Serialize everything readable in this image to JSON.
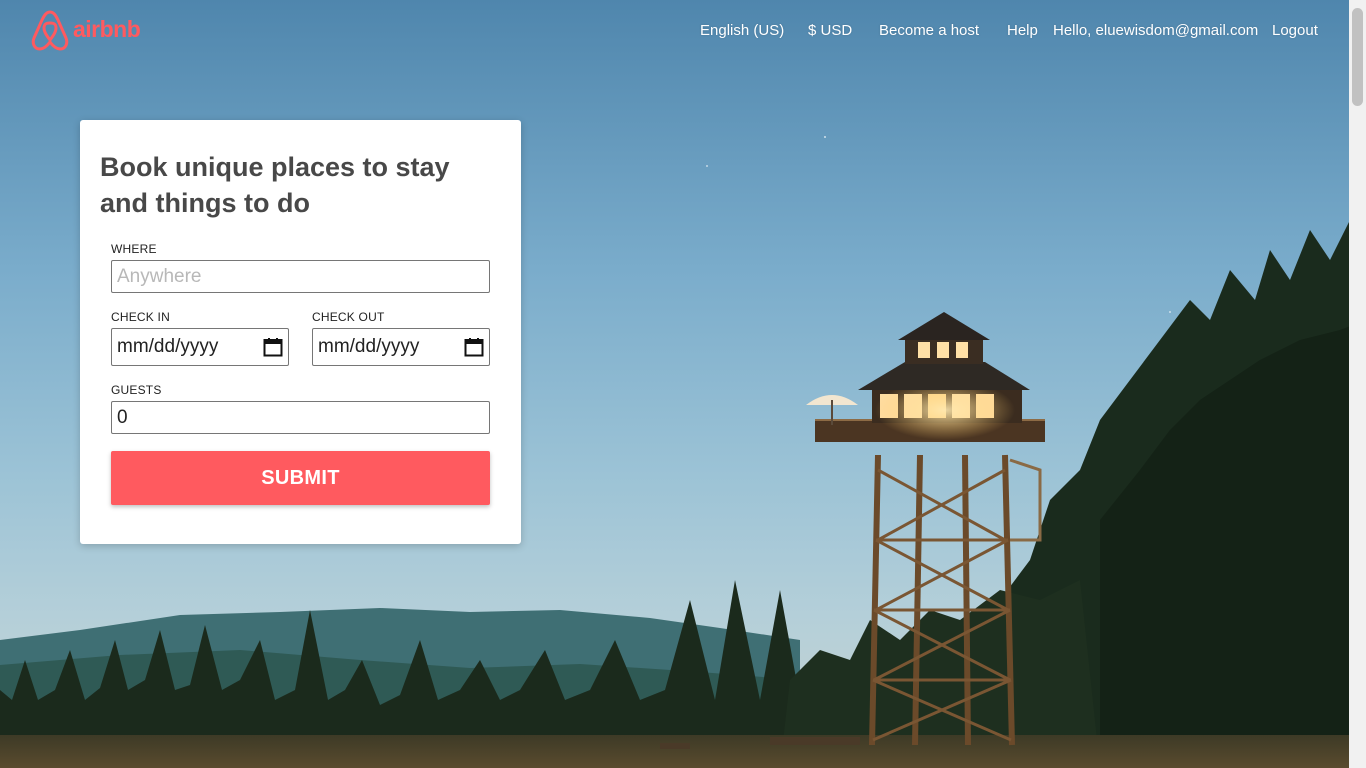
{
  "brand": {
    "name": "airbnb",
    "color": "#ff5a5f"
  },
  "nav": {
    "language": "English (US)",
    "currency": "$ USD",
    "become_host": "Become a host",
    "help": "Help",
    "greeting": "Hello, eluewisdom@gmail.com",
    "logout": "Logout"
  },
  "booking": {
    "title": "Book unique places to stay and things to do",
    "where_label": "WHERE",
    "where_placeholder": "Anywhere",
    "checkin_label": "CHECK IN",
    "checkin_value": "mm/dd/yyyy",
    "checkout_label": "CHECK OUT",
    "checkout_value": "mm/dd/yyyy",
    "guests_label": "GUESTS",
    "guests_value": "0",
    "submit_label": "SUBMIT",
    "submit_color": "#ff5a5f"
  },
  "icons": [
    "airbnb-logo-icon",
    "calendar-icon"
  ]
}
